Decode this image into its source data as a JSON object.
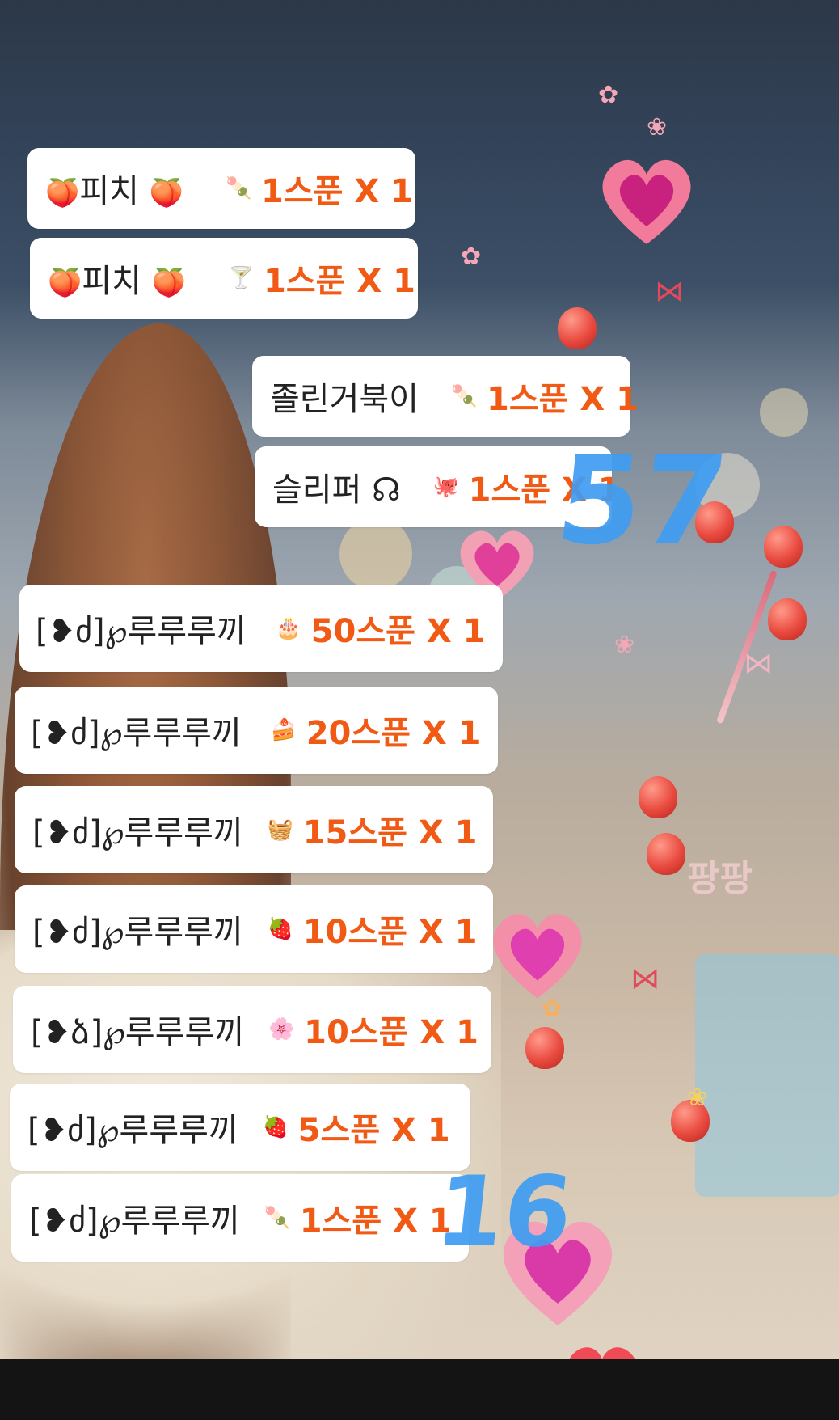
{
  "messages": [
    {
      "nick": "피치",
      "emoji": "🍑",
      "gift": "🍡",
      "amount": "1스푼 X 1"
    },
    {
      "nick": "피치",
      "emoji": "🍑",
      "gift": "🍸",
      "amount": "1스푼 X 1"
    },
    {
      "nick": "졸린거북이",
      "gift": "🍡",
      "amount": "1스푼 X 1"
    },
    {
      "nick": "슬리퍼 ☊",
      "gift": "🐙",
      "amount": "1스푼 X 1"
    },
    {
      "nick": "[❥ძ]℘루루루끼",
      "gift": "🎂",
      "amount": "50스푼 X 1"
    },
    {
      "nick": "[❥ძ]℘루루루끼",
      "gift": "🍰",
      "amount": "20스푼 X 1"
    },
    {
      "nick": "[❥ძ]℘루루루끼",
      "gift": "🧺",
      "amount": "15스푼 X 1"
    },
    {
      "nick": "[❥ძ]℘루루루끼",
      "gift": "🍓",
      "amount": "10스푼 X 1"
    },
    {
      "nick": "[❥ձ]℘루루루끼",
      "gift": "🌸",
      "amount": "10스푼 X 1"
    },
    {
      "nick": "[❥ძ]℘루루루끼",
      "gift": "🍓",
      "amount": "5스푼 X 1"
    },
    {
      "nick": "[❥ძ]℘루루루끼",
      "gift": "🍡",
      "amount": "1스푼 X 1"
    }
  ],
  "annotations": {
    "top_number": "57",
    "bottom_number": "16"
  },
  "background_text": {
    "sign": "팡팡"
  },
  "colors": {
    "amount": "#f05a14",
    "annotation": "#3f9df2",
    "bubble": "#ffffff"
  }
}
